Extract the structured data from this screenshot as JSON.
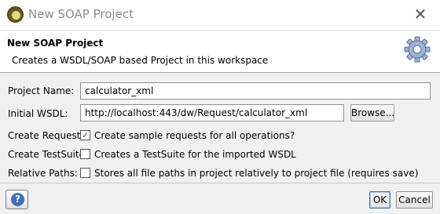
{
  "window": {
    "title": "New SOAP Project",
    "close_glyph": "✕"
  },
  "header": {
    "title": "New SOAP Project",
    "description": "Creates a WSDL/SOAP based Project in this workspace",
    "icon": "gear-icon"
  },
  "form": {
    "project_name": {
      "label": "Project Name:",
      "value": "calculator_xml"
    },
    "initial_wsdl": {
      "label": "Initial WSDL:",
      "value": "http://localhost:443/dw/Request/calculator_xml",
      "browse_label": "Browse..."
    },
    "create_requests": {
      "label": "Create Requests:",
      "checked": true,
      "text": "Create sample requests for all operations?"
    },
    "create_testsuite": {
      "label": "Create TestSuite:",
      "checked": false,
      "text": "Creates a TestSuite for the imported WSDL"
    },
    "relative_paths": {
      "label": "Relative Paths:",
      "checked": false,
      "text": "Stores all file paths in project relatively to project file (requires save)"
    }
  },
  "footer": {
    "help_glyph": "?",
    "ok_label": "OK",
    "cancel_label": "Cancel"
  }
}
